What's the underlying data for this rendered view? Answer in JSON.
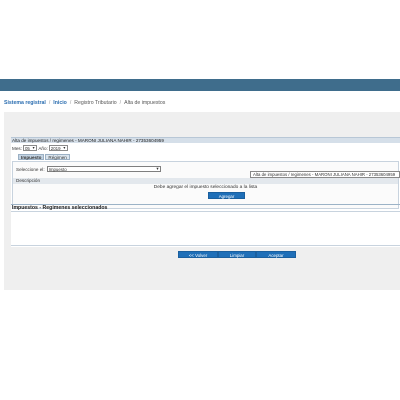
{
  "colors": {
    "topbar": "#3f6d8c",
    "link": "#2a6db0",
    "button": "#1f6fb8",
    "panel_header": "#d5dfe9",
    "content_bg": "#efefef"
  },
  "breadcrumb": {
    "items": [
      "Sistema registral",
      "Inicio",
      "Registro Tributario",
      "Alta de impuestos"
    ],
    "separator": "/"
  },
  "panel": {
    "title": "Alta de impuestos / regimenes - MARONI JULIANA NAHIR - 27353604959",
    "period": {
      "month_label": "Mes:",
      "month_value": "05",
      "year_label": "Año:",
      "year_value": "2019"
    },
    "tabs": [
      {
        "label": "Impuesto",
        "active": true
      },
      {
        "label": "Régimen",
        "active": false
      }
    ],
    "select": {
      "label": "Seleccione el:",
      "value": "Impuesto"
    },
    "tooltip_text": "Alta de impuestos / regimenes - MARONI JULIANA NAHIR - 27353604959",
    "description_label": "Descripción",
    "message": "Debe agregar el impuesto seleccionado a la lista",
    "add_button": "Agregar",
    "selected_title": "Impuestos - Regimenes seleccionados"
  },
  "footer": {
    "back_button": "<< Volver",
    "clear_button": "Limpiar",
    "accept_button": "Aceptar"
  }
}
